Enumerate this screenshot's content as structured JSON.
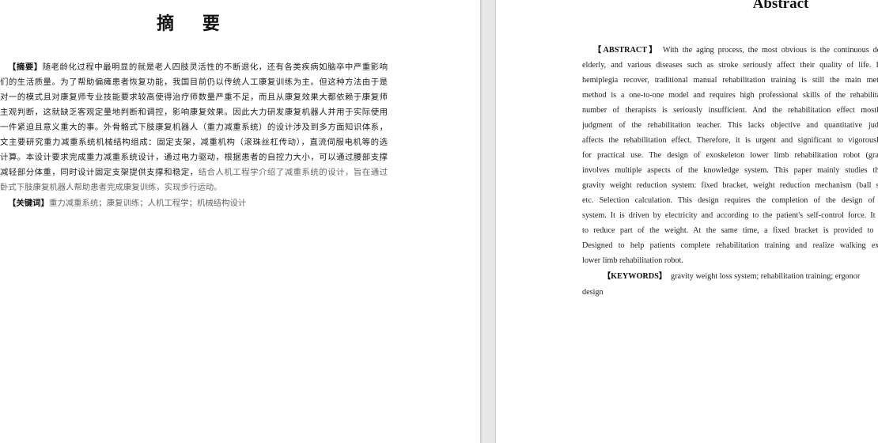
{
  "left_page": {
    "title": "摘  要",
    "lines": [
      {
        "label": "【摘要】",
        "text": "随老龄化过程中最明显的就是老人四肢灵活性的不断退化，还有各类疾病如脑卒中严重影响"
      },
      {
        "text": "们的生活质量。为了帮助偏瘫患者恢复功能，我国目前仍以传统人工康复训练为主。但这种方法由于是"
      },
      {
        "text": "对一的模式且对康复师专业技能要求较高使得治疗师数量严重不足，而且从康复效果大都依赖于康复师"
      },
      {
        "text": "主观判断，这就缺乏客观定量地判断和调控，影响康复效果。因此大力研发康复机器人并用于实际使用"
      },
      {
        "text": "一件紧迫且意义重大的事。外骨骼式下肢康复机器人（重力减重系统）的设计涉及到多方面知识体系，"
      },
      {
        "text": "文主要研究重力减重系统机械结构组成：固定支架，减重机构（滚珠丝杠传动），直流伺服电机等的选"
      },
      {
        "text": "计算。本设计要求完成重力减重系统设计，通过电力驱动，根据患者的自控力大小，可以通过腰部支撑"
      },
      {
        "text": "减轻部分体重，同时设计固定支架提供支撑和稳定，",
        "dim": "结合人机工程学介绍了减重系统的设计，旨在通过"
      },
      {
        "dim": "卧式下肢康复机器人帮助患者完成康复训练，实现步行运动。"
      }
    ],
    "keywords_label": "【关键词】",
    "keywords_text": "重力减重系统；康复训练；人机工程学；机械结构设计"
  },
  "right_page": {
    "title": "Abstract",
    "abstract_label": "【ABSTRACT】",
    "lines": [
      "With the aging process, the most obvious is the continuous det",
      "elderly, and various diseases such as stroke seriously affect their quality of life. In",
      "hemiplegia recover, traditional manual rehabilitation training is still the main meth",
      "method is a one-to-one model and requires high professional skills of the rehabilitat",
      "number of therapists is seriously insufficient. And the rehabilitation effect mostly",
      "judgment of the rehabilitation teacher. This lacks objective and quantitative judg",
      "affects the rehabilitation effect. Therefore, it is urgent and significant to vigorously",
      "for practical use. The design of exoskeleton lower limb rehabilitation robot (grav",
      "involves multiple aspects of the knowledge system. This paper mainly studies the",
      "gravity weight reduction system: fixed bracket, weight reduction mechanism (ball sc",
      "etc. Selection calculation. This design requires the completion of the design of t",
      "system. It is driven by electricity and according to the patient's self-control force. It c",
      "to reduce part of the weight. At the same time, a fixed bracket is provided to p",
      "Designed to help patients complete rehabilitation training and realize walking exe",
      "lower limb rehabilitation robot."
    ],
    "keywords_label": "【KEYWORDS】",
    "keywords_text": "gravity weight loss system; rehabilitation training; ergonor",
    "keywords_cont": "design"
  }
}
